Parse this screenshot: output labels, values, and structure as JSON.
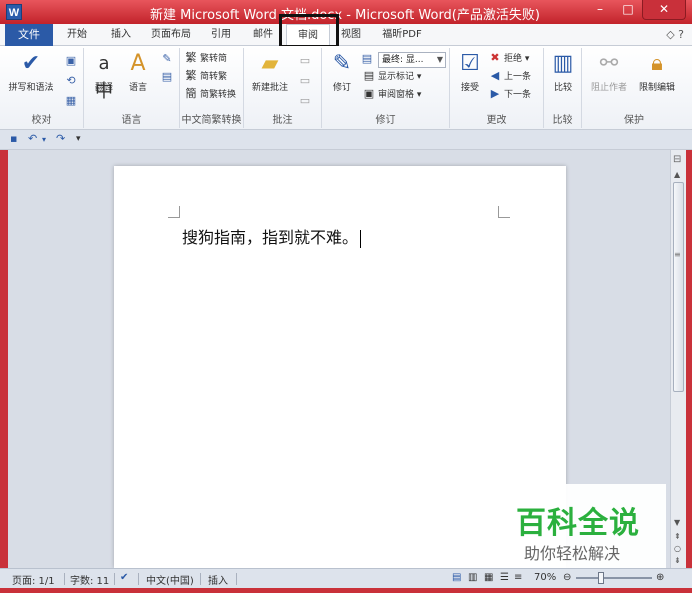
{
  "window": {
    "app_icon": "W",
    "title": "新建 Microsoft Word 文档.docx - Microsoft Word(产品激活失败)",
    "minimize": "–",
    "maximize": "□",
    "close": "✕"
  },
  "tabs": {
    "file": "文件",
    "items": [
      "开始",
      "插入",
      "页面布局",
      "引用",
      "邮件",
      "审阅",
      "视图",
      "福昕PDF"
    ],
    "active": "审阅",
    "help": "◇ ?"
  },
  "ribbon": {
    "proofing": {
      "label": "校对",
      "spell": "拼写和语法",
      "icons": [
        "research-icon",
        "thesaurus-icon",
        "word-count-icon"
      ]
    },
    "language": {
      "label": "语言",
      "translate": "翻译",
      "language": "语言"
    },
    "chinese_conversion": {
      "label": "中文简繁转换",
      "to_simplified": "繁转简",
      "to_traditional": "简转繁",
      "convert": "简繁转换"
    },
    "comments": {
      "label": "批注",
      "new_comment": "新建批注"
    },
    "tracking": {
      "label": "修订",
      "track_changes": "修订",
      "display_combo": "最终: 显...",
      "show_markup": "显示标记",
      "reviewing_pane": "审阅窗格"
    },
    "changes": {
      "label": "更改",
      "accept": "接受",
      "reject": "拒绝",
      "previous": "上一条",
      "next": "下一条"
    },
    "compare": {
      "label": "比较",
      "compare": "比较"
    },
    "protect": {
      "label": "保护",
      "block_authors": "阻止作者",
      "restrict_editing": "限制编辑"
    }
  },
  "document": {
    "text": "搜狗指南，指到就不难。"
  },
  "watermark": {
    "title": "百科全说",
    "subtitle": "助你轻松解决"
  },
  "statusbar": {
    "page": "页面: 1/1",
    "words": "字数: 11",
    "language": "中文(中国)",
    "mode": "插入",
    "zoom": "70%",
    "zoom_level": 0.7
  }
}
